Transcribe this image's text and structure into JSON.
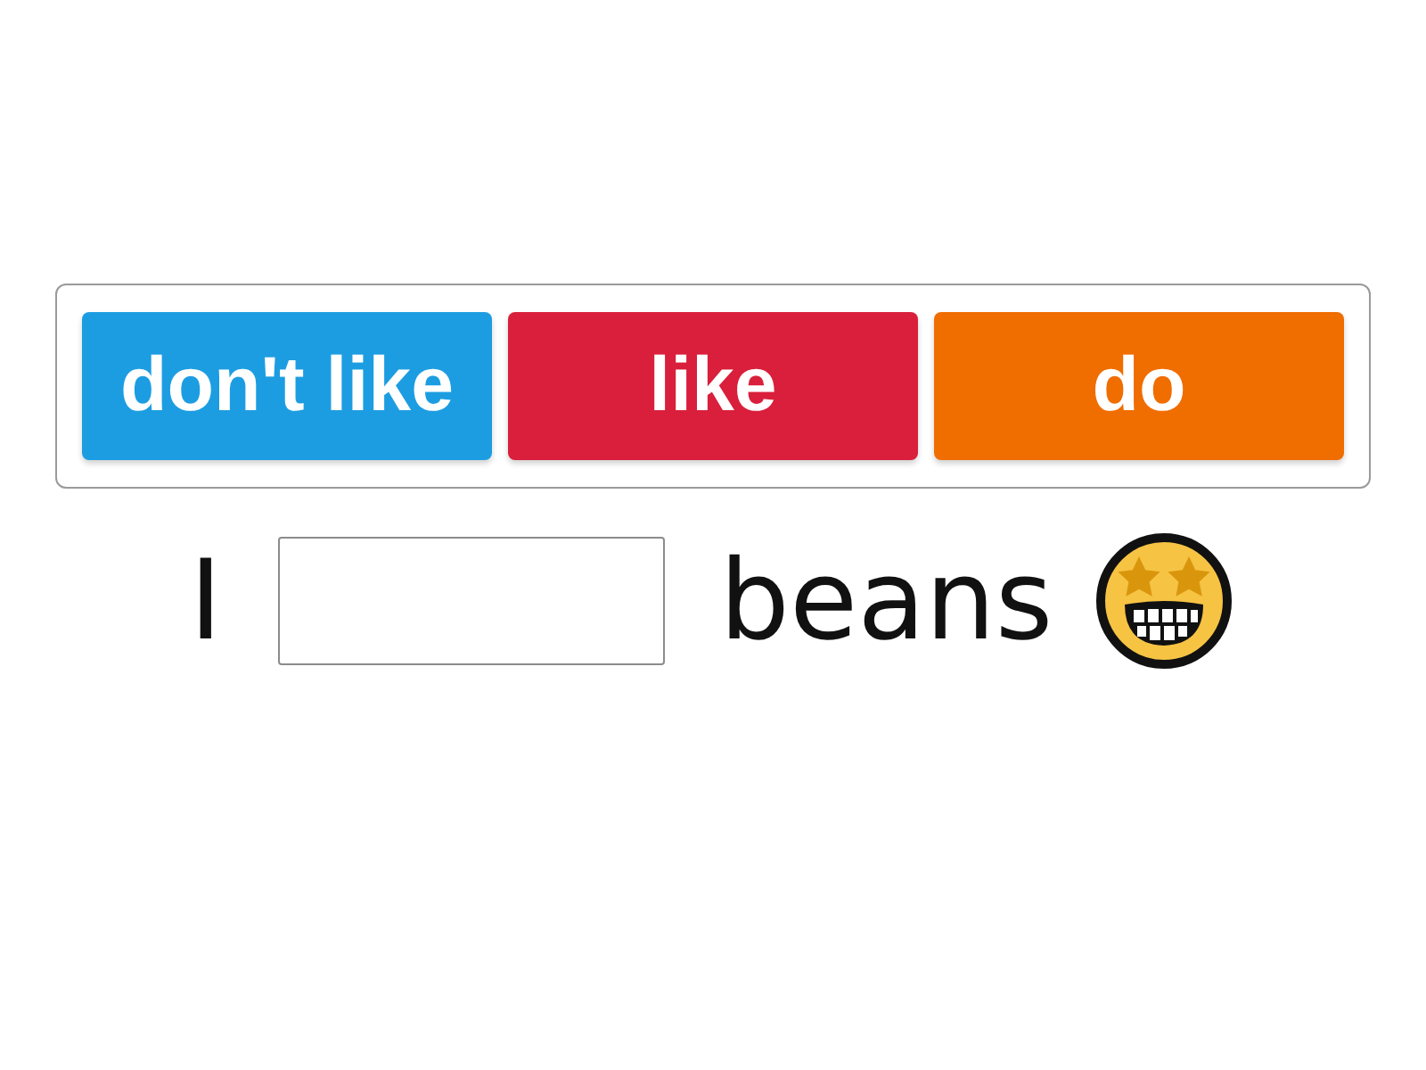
{
  "word_bank": {
    "tiles": [
      {
        "label": "don't like",
        "color": "#1d9de1"
      },
      {
        "label": "like",
        "color": "#d91f3b"
      },
      {
        "label": "do",
        "color": "#f06d00"
      }
    ]
  },
  "sentence": {
    "parts": [
      {
        "kind": "text",
        "text": "I"
      },
      {
        "kind": "blank"
      },
      {
        "kind": "text",
        "text": "beans"
      },
      {
        "kind": "emoji"
      }
    ]
  }
}
